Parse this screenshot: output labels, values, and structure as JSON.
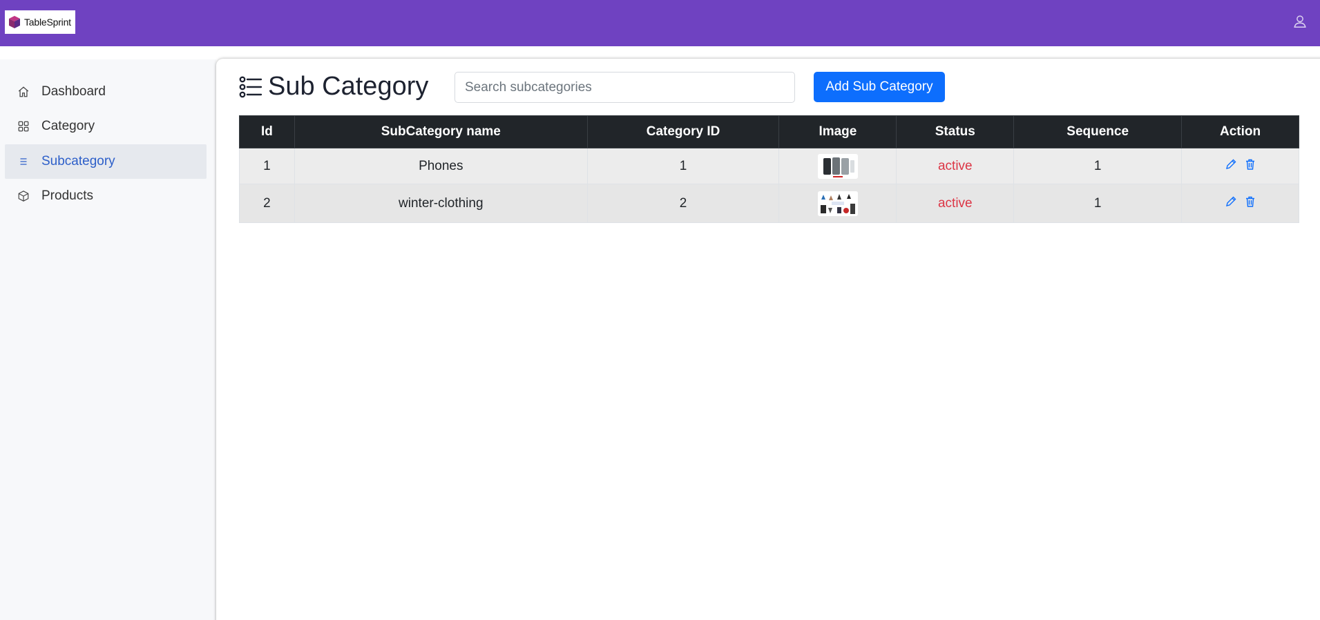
{
  "brand": {
    "name": "TableSprint"
  },
  "colors": {
    "header": "#6f42c1",
    "primary": "#0d6efd",
    "status": "#dc3545",
    "table_head": "#212529"
  },
  "sidebar": {
    "items": [
      {
        "label": "Dashboard",
        "icon": "home-icon",
        "active": false
      },
      {
        "label": "Category",
        "icon": "grid-icon",
        "active": false
      },
      {
        "label": "Subcategory",
        "icon": "list-icon",
        "active": true
      },
      {
        "label": "Products",
        "icon": "box-icon",
        "active": false
      }
    ]
  },
  "page": {
    "title": "Sub Category",
    "search_placeholder": "Search subcategories",
    "add_button": "Add Sub Category"
  },
  "table": {
    "headers": [
      "Id",
      "SubCategory name",
      "Category ID",
      "Image",
      "Status",
      "Sequence",
      "Action"
    ],
    "rows": [
      {
        "id": "1",
        "name": "Phones",
        "category_id": "1",
        "status": "active",
        "sequence": "1"
      },
      {
        "id": "2",
        "name": "winter-clothing",
        "category_id": "2",
        "status": "active",
        "sequence": "1"
      }
    ]
  }
}
